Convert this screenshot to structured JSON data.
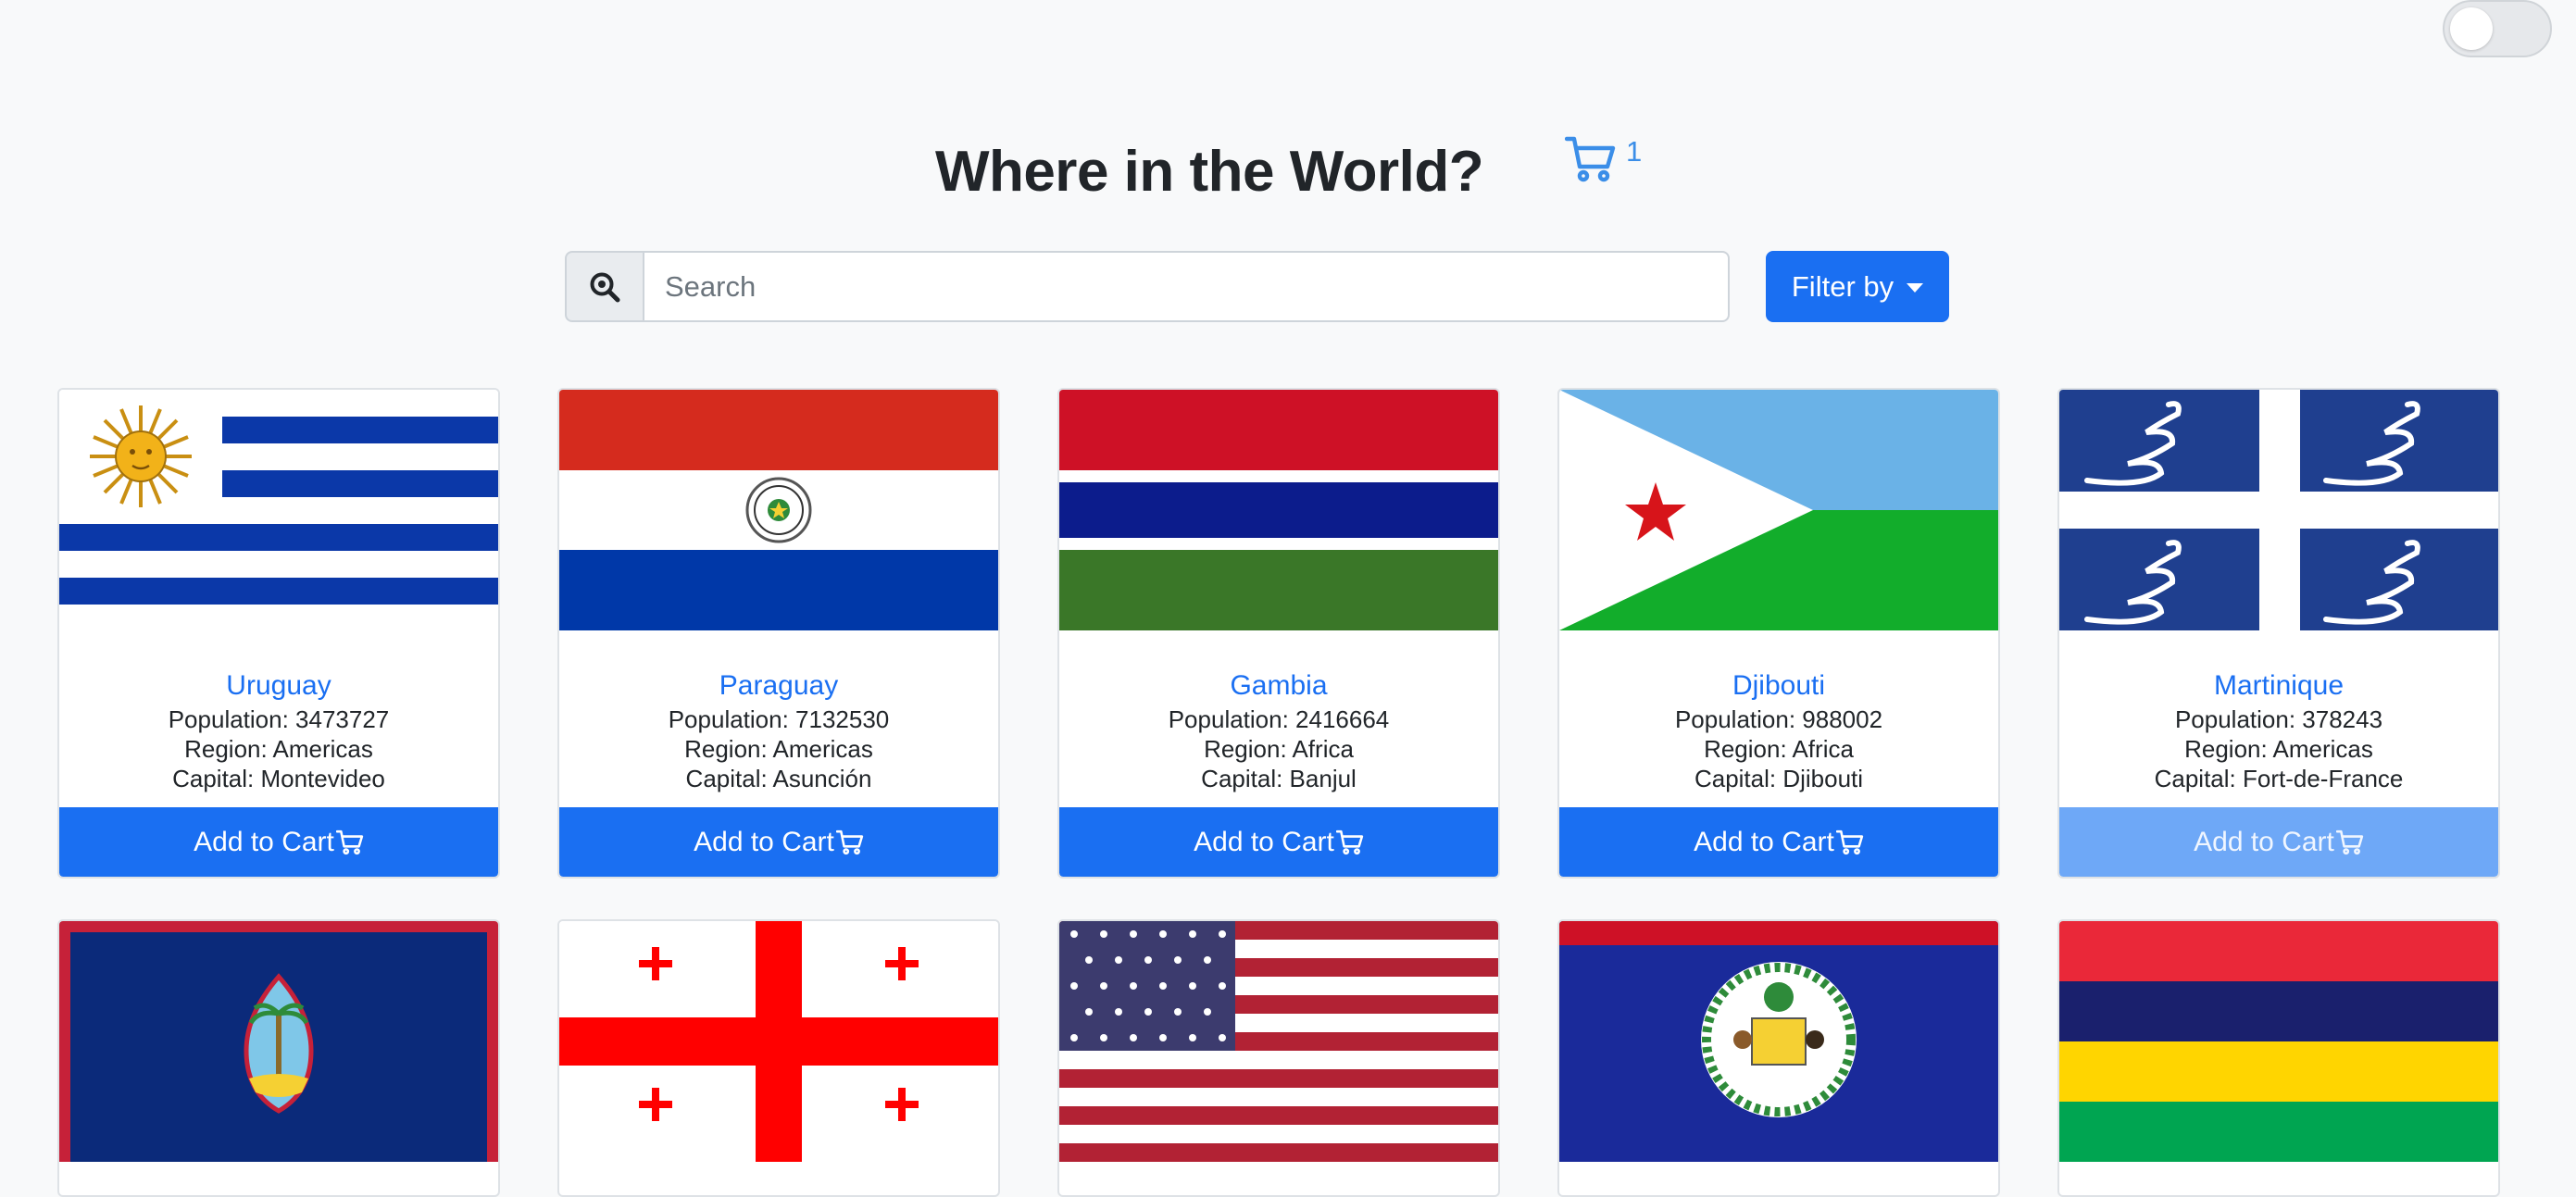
{
  "header": {
    "title": "Where in the World?",
    "cart_count": "1"
  },
  "search": {
    "placeholder": "Search",
    "value": ""
  },
  "filter": {
    "label": "Filter by"
  },
  "cards": [
    {
      "name": "Uruguay",
      "population": "Population: 3473727",
      "region": "Region: Americas",
      "capital": "Capital: Montevideo",
      "button": "Add to Cart",
      "button_state": "enabled"
    },
    {
      "name": "Paraguay",
      "population": "Population: 7132530",
      "region": "Region: Americas",
      "capital": "Capital: Asunción",
      "button": "Add to Cart",
      "button_state": "enabled"
    },
    {
      "name": "Gambia",
      "population": "Population: 2416664",
      "region": "Region: Africa",
      "capital": "Capital: Banjul",
      "button": "Add to Cart",
      "button_state": "enabled"
    },
    {
      "name": "Djibouti",
      "population": "Population: 988002",
      "region": "Region: Africa",
      "capital": "Capital: Djibouti",
      "button": "Add to Cart",
      "button_state": "enabled"
    },
    {
      "name": "Martinique",
      "population": "Population: 378243",
      "region": "Region: Americas",
      "capital": "Capital: Fort-de-France",
      "button": "Add to Cart",
      "button_state": "disabled"
    }
  ],
  "second_row_flags": [
    "guam-flag",
    "georgia-flag",
    "usa-flag",
    "belize-flag",
    "mauritius-flag"
  ],
  "colors": {
    "primary": "#1a6ff2",
    "primary_disabled": "#6ea8f7",
    "link": "#1a6ff2",
    "cart_icon": "#3b8ee8",
    "background": "#f8f9fa"
  }
}
